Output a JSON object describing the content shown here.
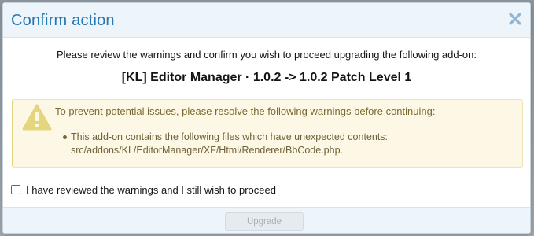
{
  "dialog": {
    "title": "Confirm action",
    "intro": "Please review the warnings and confirm you wish to proceed upgrading the following add-on:",
    "addon_name": "[KL] Editor Manager · 1.0.2 -> 1.0.2 Patch Level 1"
  },
  "warning": {
    "title": "To prevent potential issues, please resolve the following warnings before continuing:",
    "items": [
      {
        "line1": "This add-on contains the following files which have unexpected contents:",
        "line2": "src/addons/KL/EditorManager/XF/Html/Renderer/BbCode.php."
      }
    ],
    "icon": "warning-triangle-icon"
  },
  "confirm": {
    "label": "I have reviewed the warnings and I still wish to proceed",
    "checked": false
  },
  "footer": {
    "upgrade_label": "Upgrade",
    "upgrade_disabled": true
  },
  "colors": {
    "title": "#2577b1",
    "header_bg": "#edf4fa",
    "warning_bg": "#fdf8e6",
    "warning_text": "#7a6a2f"
  }
}
